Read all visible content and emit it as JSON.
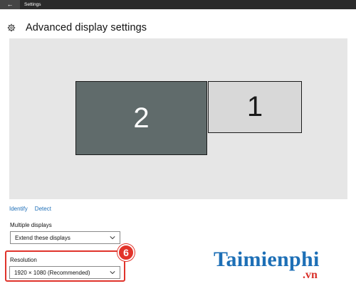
{
  "window": {
    "title": "Settings",
    "back_glyph": "←"
  },
  "header": {
    "icon": "gear-icon",
    "title": "Advanced display settings"
  },
  "display_arrangement": {
    "monitors": [
      {
        "number": "2",
        "selected": true,
        "color": "#606b6b"
      },
      {
        "number": "1",
        "selected": false,
        "color": "#d8d8d8"
      }
    ]
  },
  "links": {
    "identify": "Identify",
    "detect": "Detect"
  },
  "multiple_displays": {
    "label": "Multiple displays",
    "value": "Extend these displays"
  },
  "resolution": {
    "label": "Resolution",
    "value": "1920 × 1080 (Recommended)"
  },
  "annotation": {
    "step_number": "6",
    "highlight_color": "#e0332b"
  },
  "watermark": {
    "brand": "Taimienphi",
    "suffix": ".vn"
  },
  "colors": {
    "link": "#1f6fb8",
    "titlebar": "#2b2b2b"
  }
}
